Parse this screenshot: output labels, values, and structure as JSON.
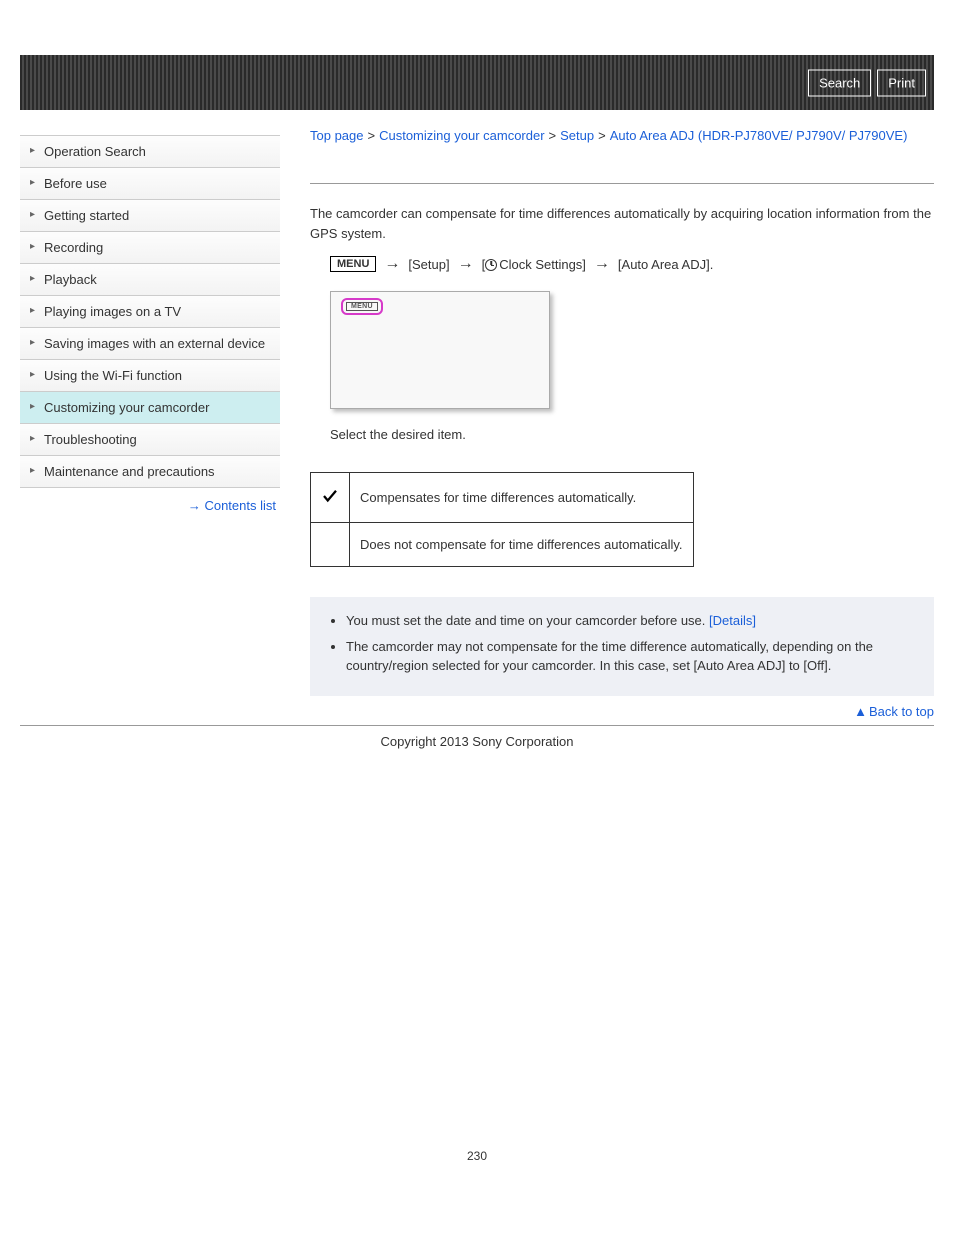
{
  "banner": {
    "search_label": "Search",
    "print_label": "Print"
  },
  "sidebar": {
    "items": [
      {
        "label": "Operation Search",
        "active": false
      },
      {
        "label": "Before use",
        "active": false
      },
      {
        "label": "Getting started",
        "active": false
      },
      {
        "label": "Recording",
        "active": false
      },
      {
        "label": "Playback",
        "active": false
      },
      {
        "label": "Playing images on a TV",
        "active": false
      },
      {
        "label": "Saving images with an external device",
        "active": false
      },
      {
        "label": "Using the Wi-Fi function",
        "active": false
      },
      {
        "label": "Customizing your camcorder",
        "active": true
      },
      {
        "label": "Troubleshooting",
        "active": false
      },
      {
        "label": "Maintenance and precautions",
        "active": false
      }
    ],
    "contents_link": "Contents list"
  },
  "breadcrumb": {
    "items": [
      "Top page",
      "Customizing your camcorder",
      "Setup",
      "Auto Area ADJ (HDR-PJ780VE/ PJ790V/ PJ790VE)"
    ]
  },
  "content": {
    "intro": "The camcorder can compensate for time differences automatically by acquiring location information from the GPS system.",
    "menu_box": "MENU",
    "flow_setup": "[Setup]",
    "flow_clock": "Clock Settings]",
    "flow_auto": "[Auto Area ADJ].",
    "menu_badge": "MENU",
    "select_text": "Select the desired item.",
    "table": {
      "row1": "Compensates for time differences automatically.",
      "row2": "Does not compensate for time differences automatically."
    },
    "notes": {
      "n1a": "You must set the date and time on your camcorder before use. ",
      "n1b": "[Details]",
      "n2": "The camcorder may not compensate for the time difference automatically, depending on the country/region selected for your camcorder. In this case, set [Auto Area ADJ] to [Off]."
    },
    "back_to_top": "Back to top"
  },
  "footer": {
    "copyright": "Copyright 2013 Sony Corporation",
    "page_num": "230"
  }
}
